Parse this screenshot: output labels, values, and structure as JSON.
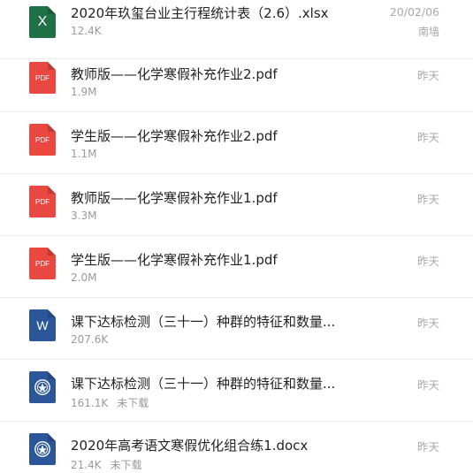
{
  "files": [
    {
      "name": "2020年玖玺台业主行程统计表（2.6）.xlsx",
      "size": "12.4K",
      "date": "20/02/06",
      "source": "南墙",
      "icon": "excel-file-icon",
      "icon_text": "X",
      "color": "#1e7145"
    },
    {
      "name": "教师版——化学寒假补充作业2.pdf",
      "size": "1.9M",
      "date": "昨天",
      "icon": "pdf-file-icon",
      "icon_text": "PDF",
      "color": "#e9473f"
    },
    {
      "name": "学生版——化学寒假补充作业2.pdf",
      "size": "1.1M",
      "date": "昨天",
      "icon": "pdf-file-icon",
      "icon_text": "PDF",
      "color": "#e9473f"
    },
    {
      "name": "教师版——化学寒假补充作业1.pdf",
      "size": "3.3M",
      "date": "昨天",
      "icon": "pdf-file-icon",
      "icon_text": "PDF",
      "color": "#e9473f"
    },
    {
      "name": "学生版——化学寒假补充作业1.pdf",
      "size": "2.0M",
      "date": "昨天",
      "icon": "pdf-file-icon",
      "icon_text": "PDF",
      "color": "#e9473f"
    },
    {
      "name": "课下达标检测（三十一）种群的特征和数量...",
      "size": "207.6K",
      "date": "昨天",
      "icon": "word-file-icon",
      "icon_text": "W",
      "color": "#2b579a"
    },
    {
      "name": "课下达标检测（三十一）种群的特征和数量...",
      "size": "161.1K",
      "status": "未下载",
      "date": "昨天",
      "icon": "word-emblem-file-icon",
      "color": "#2b579a"
    },
    {
      "name": "2020年高考语文寒假优化组合练1.docx",
      "size": "21.4K",
      "status": "未下载",
      "date": "昨天",
      "icon": "word-emblem-file-icon",
      "color": "#2b579a"
    }
  ]
}
